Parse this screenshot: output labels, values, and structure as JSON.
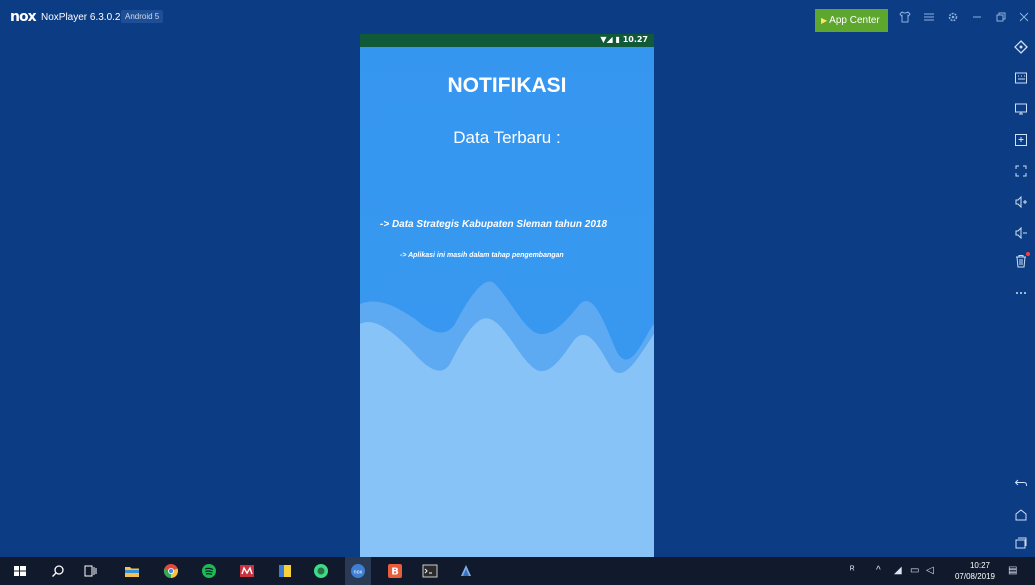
{
  "window": {
    "app_title": "NoxPlayer 6.3.0.2",
    "android_badge": "Android 5",
    "logo_text": "nox",
    "app_center_label": "App Center",
    "titlebar_icons": [
      "shirt-icon",
      "menu-icon",
      "settings-icon",
      "minimize-icon",
      "restore-icon",
      "close-icon"
    ]
  },
  "phone": {
    "status_time": "10.27",
    "title": "NOTIFIKASI",
    "subtitle": "Data Terbaru :",
    "data_line": "-> Data Strategis Kabupaten Sleman tahun 2018",
    "dev_note": "-> Aplikasi ini masih dalam tahap pengembangan"
  },
  "right_toolbar": {
    "items": [
      "location-icon",
      "keyboard-icon",
      "screen-icon",
      "screenshot-icon",
      "fullscreen-icon",
      "volume-up-icon",
      "volume-down-icon",
      "trash-icon",
      "more-icon"
    ],
    "nav": [
      "back-icon",
      "home-icon",
      "recents-icon"
    ]
  },
  "taskbar": {
    "apps": [
      "windows-start",
      "search",
      "task-view",
      "file-explorer",
      "chrome",
      "spotify",
      "app-m",
      "sticky-notes",
      "android-studio",
      "nox",
      "app-b",
      "terminal",
      "app-blue"
    ],
    "clock_time": "10:27",
    "clock_date": "07/08/2019"
  },
  "colors": {
    "frame": "#0b3c84",
    "phone_bg": "#3596f0",
    "wave_front": "#87c3f6",
    "app_center": "#5da72e",
    "status_bar": "#105a3a"
  }
}
